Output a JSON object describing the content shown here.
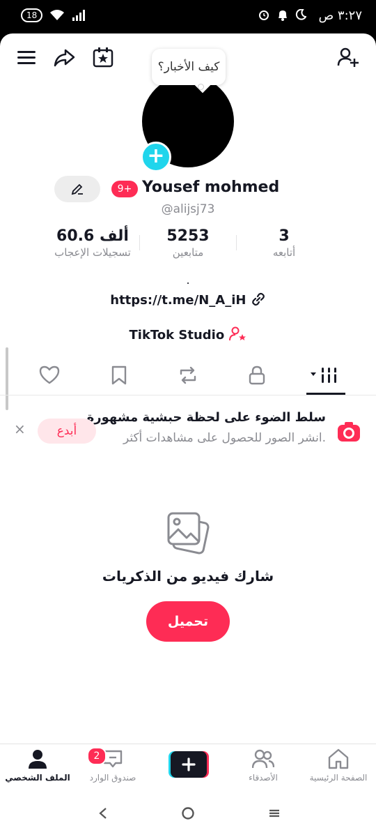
{
  "status_bar": {
    "time": "٣:٢٧ ص",
    "battery": "18"
  },
  "profile": {
    "bubble_text": "كيف الأخبار؟",
    "notification_badge": "9+",
    "name": "Yousef mohmed",
    "handle": "@alijsj73",
    "stats": [
      {
        "value": "60.6 ألف",
        "label": "تسجيلات الإعجاب"
      },
      {
        "value": "5253",
        "label": "متابعين"
      },
      {
        "value": "3",
        "label": "أتابعه"
      }
    ],
    "bio_dot": ".",
    "link": "https://t.me/N_A_iH",
    "studio": "TikTok Studio"
  },
  "promo": {
    "title": "سلط الضوء على لحظة حبشية مشهورة",
    "subtitle": "انشر الصور للحصول على مشاهدات أكثر.",
    "create_label": "أبدع",
    "close_symbol": "×"
  },
  "empty_state": {
    "text": "شارك فيديو من الذكريات",
    "upload_label": "تحميل"
  },
  "bottom_nav": {
    "items": [
      {
        "label": "الملف الشخصي"
      },
      {
        "label": "صندوق الوارد",
        "badge": "2"
      },
      {
        "label": ""
      },
      {
        "label": "الأصدقاء"
      },
      {
        "label": "الصفحة الرئيسية"
      }
    ]
  },
  "colors": {
    "accent": "#fe2c55",
    "cyan": "#20d5ec",
    "text": "#161823",
    "muted": "#8a8b91"
  }
}
